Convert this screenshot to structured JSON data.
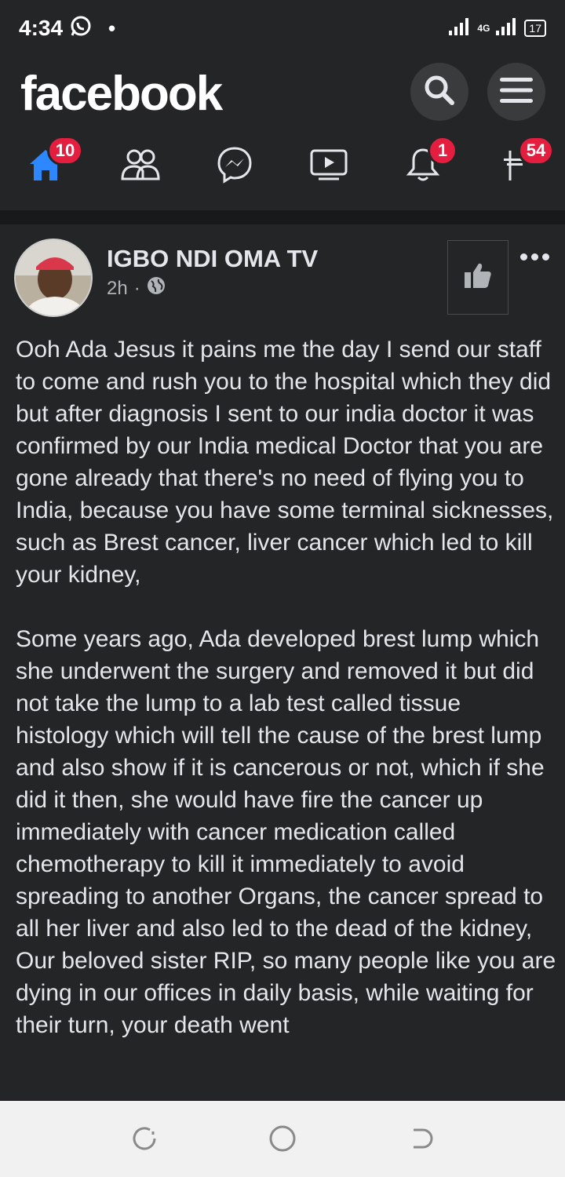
{
  "status_bar": {
    "time": "4:34",
    "network": "4G",
    "battery": "17"
  },
  "header": {
    "logo": "facebook",
    "search_icon": "search-icon",
    "menu_icon": "hamburger-menu-icon"
  },
  "nav": {
    "items": [
      {
        "name": "home",
        "icon": "home-icon",
        "badge": "10"
      },
      {
        "name": "friends",
        "icon": "friends-icon",
        "badge": ""
      },
      {
        "name": "messenger",
        "icon": "messenger-icon",
        "badge": ""
      },
      {
        "name": "watch",
        "icon": "video-icon",
        "badge": ""
      },
      {
        "name": "notifications",
        "icon": "bell-icon",
        "badge": "1"
      },
      {
        "name": "marketplace",
        "icon": "flag-icon",
        "badge": "54"
      }
    ],
    "active_color": "#2d88ff"
  },
  "post": {
    "page_name": "IGBO NDI OMA TV",
    "time": "2h",
    "separator": "·",
    "audience_icon": "globe-icon",
    "paragraphs": [
      "Ooh Ada Jesus it pains me the day I send our staff to come and rush you to the hospital which they did but after diagnosis I sent to our india doctor it was confirmed by our India medical Doctor that you are gone already that there's no need of flying you to India, because you have some terminal sicknesses, such as Brest cancer, liver cancer which led to kill your kidney,",
      "Some years ago, Ada developed brest lump which she underwent the surgery and removed it but did not take the lump to a lab test called tissue histology which will tell the cause of the brest lump and also show if it is cancerous or not, which if she did it then, she would have fire the cancer up immediately with cancer medication called chemotherapy to kill it immediately to avoid spreading to another Organs, the cancer spread to all her liver and also led to the dead of the kidney, Our beloved sister RIP, so many people like you are dying in our offices in daily basis, while waiting for their turn, your death went"
    ]
  },
  "colors": {
    "background": "#242526",
    "badge": "#e41e3f",
    "text": "#e4e6eb"
  }
}
